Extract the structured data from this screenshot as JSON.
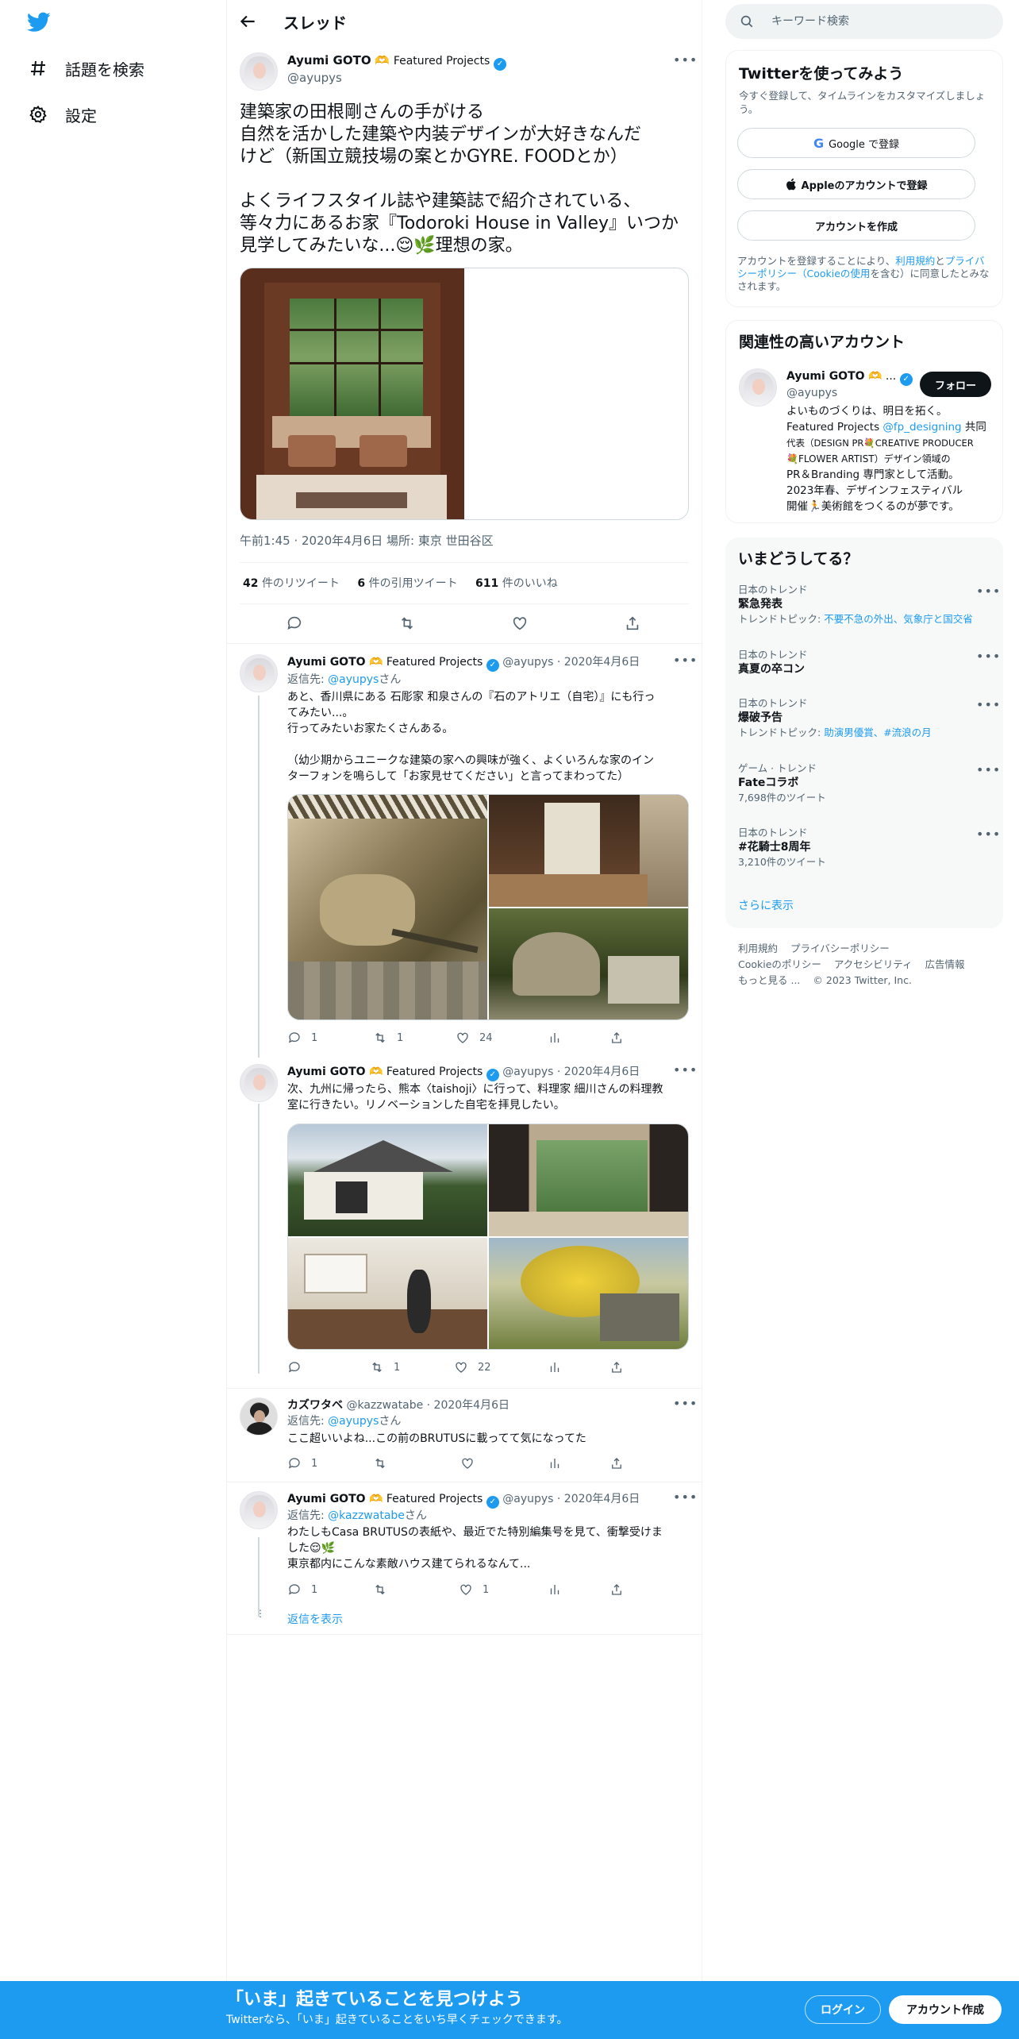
{
  "nav": {
    "explore_label": "話題を検索",
    "settings_label": "設定"
  },
  "header": {
    "title": "スレッド"
  },
  "main_tweet": {
    "name": "Ayumi GOTO",
    "emoji": "🫶",
    "affiliation": "Featured Projects",
    "handle": "@ayupys",
    "text_line1": "建築家の田根剛さんの手がける",
    "text_line2": "自然を活かした建築や内装デザインが大好きなんだ",
    "text_line3": "けど（新国立競技場の案とかGYRE. FOODとか）",
    "text_line4": "よくライフスタイル誌や建築誌で紹介されている、",
    "text_line5": "等々力にあるお家『Todoroki House in Valley』いつか",
    "text_line6": "見学してみたいな...😌🌿理想の家。",
    "meta": "午前1:45 · 2020年4月6日 場所: 東京 世田谷区",
    "retweets_count": "42",
    "retweets_label": "件のリツイート",
    "quotes_count": "6",
    "quotes_label": "件の引用ツイート",
    "likes_count": "611",
    "likes_label": "件のいいね"
  },
  "replies": [
    {
      "name": "Ayumi GOTO",
      "emoji": "🫶",
      "affiliation": "Featured Projects",
      "handle": "@ayupys",
      "date": "· 2020年4月6日",
      "reply_to_prefix": "返信先: ",
      "reply_to": "@ayupys",
      "reply_to_suffix": "さん",
      "text_line1": "あと、香川県にある 石彫家 和泉さんの『石のアトリエ（自宅）』にも行っ",
      "text_line2": "てみたい...。",
      "text_line3": "行ってみたいお家たくさんある。",
      "text_line4": "（幼少期からユニークな建築の家への興味が強く、よくいろんな家のイン",
      "text_line5": "ターフォンを鳴らして「お家見せてください」と言ってまわってた）",
      "reply_count": "1",
      "retweet_count": "1",
      "like_count": "24"
    },
    {
      "name": "Ayumi GOTO",
      "emoji": "🫶",
      "affiliation": "Featured Projects",
      "handle": "@ayupys",
      "date": "· 2020年4月6日",
      "text_line1": "次、九州に帰ったら、熊本〈taishoji〉に行って、料理家 細川さんの料理教",
      "text_line2": "室に行きたい。リノベーションした自宅を拝見したい。",
      "reply_count": "",
      "retweet_count": "1",
      "like_count": "22"
    },
    {
      "name": "カズワタベ",
      "handle": "@kazzwatabe",
      "date": "· 2020年4月6日",
      "reply_to_prefix": "返信先: ",
      "reply_to": "@ayupys",
      "reply_to_suffix": "さん",
      "text_line1": "ここ超いいよね...この前のBRUTUSに載ってて気になってた",
      "reply_count": "1",
      "retweet_count": "",
      "like_count": ""
    },
    {
      "name": "Ayumi GOTO",
      "emoji": "🫶",
      "affiliation": "Featured Projects",
      "handle": "@ayupys",
      "date": "· 2020年4月6日",
      "reply_to_prefix": "返信先: ",
      "reply_to": "@kazzwatabe",
      "reply_to_suffix": "さん",
      "text_line1": "わたしもCasa BRUTUSの表紙や、最近でた特別編集号を見て、衝撃受けま",
      "text_line2": "した😌🌿",
      "text_line3": "東京都内にこんな素敵ハウス建てられるなんて...",
      "reply_count": "1",
      "retweet_count": "",
      "like_count": "1"
    }
  ],
  "show_replies": "返信を表示",
  "right": {
    "search_placeholder": "キーワード検索",
    "signup": {
      "title": "Twitterを使ってみよう",
      "subtitle": "今すぐ登録して、タイムラインをカスタマイズしましょう。",
      "google_label": "Google で登録",
      "apple_label": "Appleのアカウントで登録",
      "create_label": "アカウントを作成",
      "legal_1": "アカウントを登録することにより、",
      "legal_terms": "利用規約",
      "legal_2": "と",
      "legal_privacy": "プライバシーポリシー（Cookieの使用",
      "legal_3": "を含む）に同意したとみなされます。"
    },
    "related": {
      "title": "関連性の高いアカウント",
      "name": "Ayumi GOTO",
      "emoji": "🫶 ...",
      "handle": "@ayupys",
      "follow_label": "フォロー",
      "bio_line1": "よいものづくりは、明日を拓く。",
      "bio_line2a": "Featured Projects ",
      "bio_link": "@fp_designing",
      "bio_line2b": " 共同",
      "bio_line3": "代表（DESIGN PR💐CREATIVE PRODUCER",
      "bio_line4": "💐FLOWER ARTIST）デザイン領域の",
      "bio_line5": "PR＆Branding 専門家として活動。",
      "bio_line6": "2023年春、デザインフェスティバル",
      "bio_line7": "開催🏃美術館をつくるのが夢です。"
    },
    "trends": {
      "title": "いまどうしてる？",
      "items": [
        {
          "context": "日本のトレンド",
          "name": "緊急発表",
          "detail_prefix": "トレンドトピック: ",
          "detail_link": "不要不急の外出、気象庁と国交省"
        },
        {
          "context": "日本のトレンド",
          "name": "真夏の卒コン",
          "detail_prefix": "",
          "detail_link": ""
        },
        {
          "context": "日本のトレンド",
          "name": "爆破予告",
          "detail_prefix": "トレンドトピック: ",
          "detail_link": "助演男優賞、#流浪の月"
        },
        {
          "context": "ゲーム · トレンド",
          "name": "Fateコラボ",
          "detail_prefix": "7,698件のツイート",
          "detail_link": ""
        },
        {
          "context": "日本のトレンド",
          "name": "#花騎士8周年",
          "detail_prefix": "3,210件のツイート",
          "detail_link": ""
        }
      ],
      "show_more": "さらに表示"
    },
    "footer": {
      "terms": "利用規約",
      "privacy": "プライバシーポリシー",
      "cookie": "Cookieのポリシー",
      "accessibility": "アクセシビリティ",
      "ads": "広告情報",
      "more": "もっと見る ...",
      "copyright": "© 2023 Twitter, Inc."
    }
  },
  "banner": {
    "title": "「いま」起きていることを見つけよう",
    "subtitle": "Twitterなら、「いま」起きていることをいち早くチェックできます。",
    "login_label": "ログイン",
    "signup_label": "アカウント作成"
  },
  "colors": {
    "accent": "#1d9bf0",
    "text": "#0f1419",
    "muted": "#536471",
    "border": "#eff3f4"
  }
}
